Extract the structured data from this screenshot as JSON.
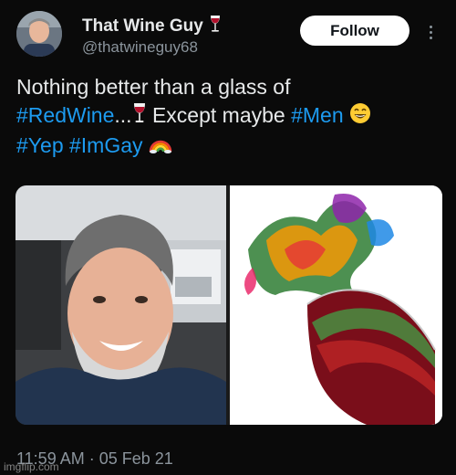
{
  "author": {
    "display_name": "That Wine Guy",
    "handle": "@thatwineguy68"
  },
  "follow_label": "Follow",
  "tweet": {
    "line1": "Nothing better than a glass of",
    "hashtag_redwine": "#RedWine",
    "ellipsis": "...",
    "text_except": " Except maybe ",
    "hashtag_men": "#Men",
    "hashtag_yep": "#Yep",
    "hashtag_imgay": "#ImGay"
  },
  "timestamp": "11:59 AM · 05 Feb 21",
  "watermark": "imgflip.com",
  "icons": {
    "name_emoji": "wine-glass-icon",
    "more": "more-options-icon",
    "smile": "grinning-face-icon",
    "rainbow": "rainbow-icon"
  },
  "colors": {
    "background": "#0a0a0a",
    "text": "#e7e9ea",
    "secondary": "#8b949c",
    "hashtag": "#1d9bf0",
    "follow_bg": "#ffffff"
  }
}
